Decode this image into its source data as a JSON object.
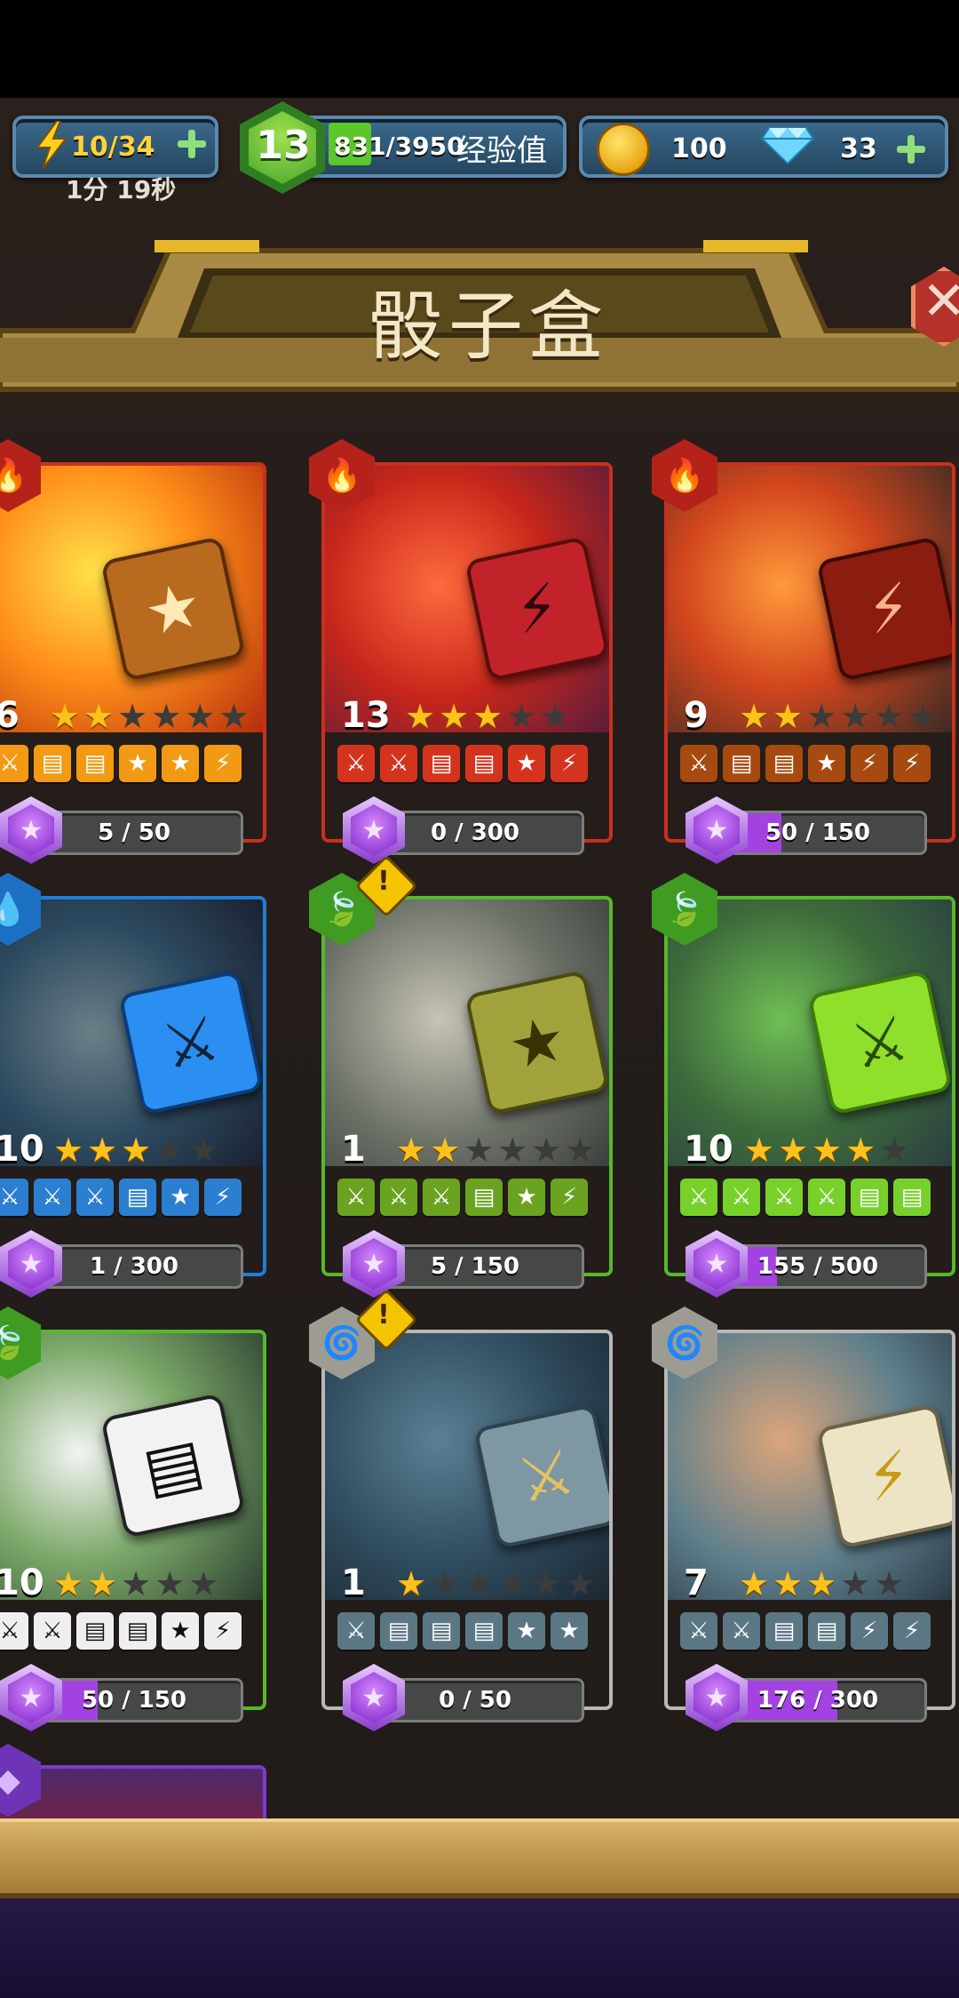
{
  "hud": {
    "energy": "10/34",
    "energy_timer": "1分 19秒",
    "level": "13",
    "xp": "831/3950",
    "xp_label": "经验值",
    "coins": "100",
    "gems": "33"
  },
  "title": "骰子盒",
  "cards": [
    {
      "level": "6",
      "stars": 2,
      "progress": "5 / 50",
      "progress_fraction": 0.1,
      "faces": [
        "⚔",
        "▤",
        "▤",
        "★",
        "★",
        "⚡"
      ]
    },
    {
      "level": "13",
      "stars": 3,
      "progress": "0 / 300",
      "progress_fraction": 0,
      "faces": [
        "⚔",
        "⚔",
        "▤",
        "▤",
        "★",
        "⚡"
      ]
    },
    {
      "level": "9",
      "stars": 2,
      "progress": "50 / 150",
      "progress_fraction": 0.33,
      "faces": [
        "⚔",
        "▤",
        "▤",
        "★",
        "⚡",
        "⚡"
      ]
    },
    {
      "level": "10",
      "stars": 3,
      "progress": "1 / 300",
      "progress_fraction": 0.01,
      "faces": [
        "⚔",
        "⚔",
        "⚔",
        "▤",
        "★",
        "⚡"
      ]
    },
    {
      "level": "1",
      "stars": 2,
      "progress": "5 / 150",
      "progress_fraction": 0.03,
      "faces": [
        "⚔",
        "⚔",
        "⚔",
        "▤",
        "★",
        "⚡"
      ]
    },
    {
      "level": "10",
      "stars": 4,
      "progress": "155 / 500",
      "progress_fraction": 0.31,
      "faces": [
        "⚔",
        "⚔",
        "⚔",
        "⚔",
        "▤",
        "▤"
      ]
    },
    {
      "level": "10",
      "stars": 2,
      "progress": "50 / 150",
      "progress_fraction": 0.33,
      "faces": [
        "⚔",
        "⚔",
        "▤",
        "▤",
        "★",
        "⚡"
      ]
    },
    {
      "level": "1",
      "stars": 1,
      "progress": "0 / 50",
      "progress_fraction": 0,
      "faces": [
        "⚔",
        "▤",
        "▤",
        "▤",
        "★",
        "★"
      ]
    },
    {
      "level": "7",
      "stars": 3,
      "progress": "176 / 300",
      "progress_fraction": 0.59,
      "faces": [
        "⚔",
        "⚔",
        "▤",
        "▤",
        "⚡",
        "⚡"
      ]
    }
  ],
  "colors": {
    "fire": "#c8301e",
    "water": "#1f7ed6",
    "nature": "#56b82a",
    "neutral": "#b7b9b6",
    "progress": "#a342e0",
    "star": "#ffc21a"
  }
}
